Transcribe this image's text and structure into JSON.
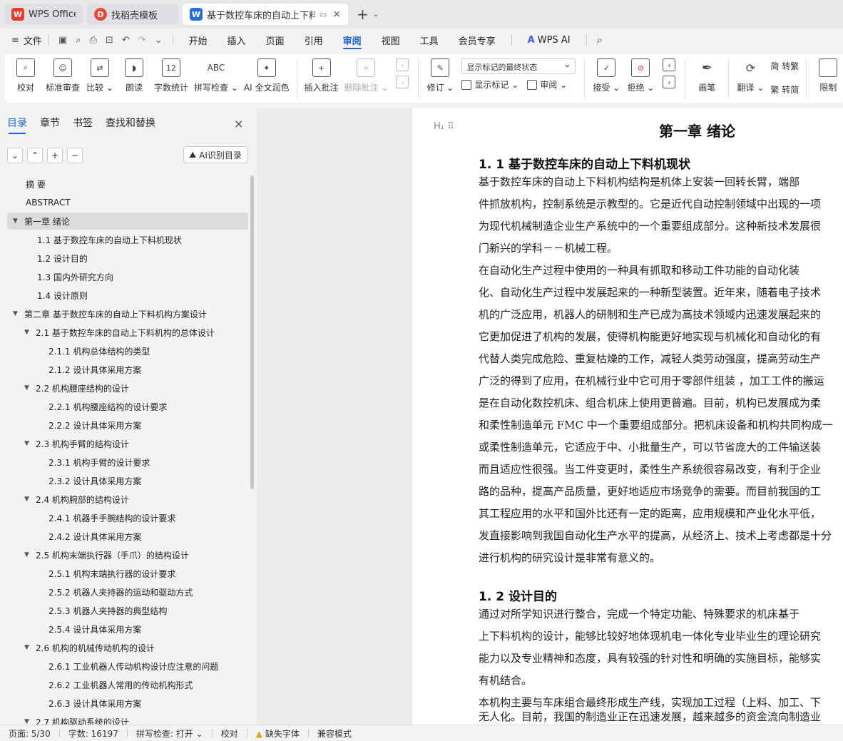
{
  "tabs": [
    {
      "label": "WPS Office",
      "logo": "W"
    },
    {
      "label": "找稻壳模板",
      "logo": "D"
    },
    {
      "label": "基于数控车床的自动上下料机",
      "logo": "W"
    }
  ],
  "menu": {
    "file": "文件",
    "items": [
      "开始",
      "插入",
      "页面",
      "引用",
      "审阅",
      "视图",
      "工具",
      "会员专享"
    ],
    "ai": "WPS AI",
    "ai_icon": "A"
  },
  "ribbon": {
    "proofread": "校对",
    "std_review": "标准审查",
    "compare": "比较",
    "read_aloud": "朗读",
    "word_count": "字数统计",
    "word_count_icon": "12",
    "spell_check": "拼写检查",
    "spell_icon": "ABC",
    "ai_polish": "AI 全文润色",
    "insert_comment": "插入批注",
    "delete_comment": "删除批注",
    "markup_state": "显示标记的最终状态",
    "track": "修订",
    "show_markup": "显示标记",
    "review": "审阅",
    "accept": "接受",
    "reject": "拒绝",
    "pen": "画笔",
    "translate": "翻译",
    "trad": "简 转繁",
    "simp": "繁 转简",
    "restrict": "限制"
  },
  "sidebar": {
    "tabs": [
      "目录",
      "章节",
      "书签",
      "查找和替换"
    ],
    "ai_toc": "AI识别目录",
    "close_icon": "×",
    "tools": [
      "⌄",
      "⌃",
      "+",
      "−"
    ],
    "toc": [
      {
        "label": "摘  要",
        "level": 0,
        "caret": ""
      },
      {
        "label": "ABSTRACT",
        "level": 0,
        "caret": ""
      },
      {
        "label": "第一章  绪论",
        "level": 0,
        "caret": "▼",
        "selected": true
      },
      {
        "label": "1.1 基于数控车床的自动上下料机现状",
        "level": 1,
        "caret": ""
      },
      {
        "label": "1.2 设计目的",
        "level": 1,
        "caret": ""
      },
      {
        "label": "1.3  国内外研究方向",
        "level": 1,
        "caret": ""
      },
      {
        "label": "1.4  设计原则",
        "level": 1,
        "caret": ""
      },
      {
        "label": "第二章    基于数控车床的自动上下料机构方案设计",
        "level": 0,
        "caret": "▼"
      },
      {
        "label": "2.1 基于数控车床的自动上下料机构的总体设计",
        "level": 1,
        "caret": "▼"
      },
      {
        "label": "2.1.1  机构总体结构的类型",
        "level": 2,
        "caret": ""
      },
      {
        "label": "2.1.2  设计具体采用方案",
        "level": 2,
        "caret": ""
      },
      {
        "label": "2.2  机构腰座结构的设计",
        "level": 1,
        "caret": "▼"
      },
      {
        "label": "2.2.1  机构腰座结构的设计要求",
        "level": 2,
        "caret": ""
      },
      {
        "label": "2.2.2  设计具体采用方案",
        "level": 2,
        "caret": ""
      },
      {
        "label": "2.3  机构手臂的结构设计",
        "level": 1,
        "caret": "▼"
      },
      {
        "label": "2.3.1  机构手臂的设计要求",
        "level": 2,
        "caret": ""
      },
      {
        "label": "2.3.2  设计具体采用方案",
        "level": 2,
        "caret": ""
      },
      {
        "label": "2.4  机构腕部的结构设计",
        "level": 1,
        "caret": "▼"
      },
      {
        "label": "2.4.1   机器手手腕结构的设计要求",
        "level": 2,
        "caret": ""
      },
      {
        "label": "2.4.2 设计具体采用方案",
        "level": 2,
        "caret": ""
      },
      {
        "label": "2.5 机构末端执行器（手爪）的结构设计",
        "level": 1,
        "caret": "▼"
      },
      {
        "label": "2.5.1 机构末端执行器的设计要求",
        "level": 2,
        "caret": ""
      },
      {
        "label": "2.5.2 机器人夹持器的运动和驱动方式",
        "level": 2,
        "caret": ""
      },
      {
        "label": "2.5.3  机器人夹持器的典型结构",
        "level": 2,
        "caret": ""
      },
      {
        "label": "2.5.4 设计具体采用方案",
        "level": 2,
        "caret": ""
      },
      {
        "label": "2.6 机构的机械传动机构的设计",
        "level": 1,
        "caret": "▼"
      },
      {
        "label": "2.6.1 工业机器人传动机构设计应注意的问题",
        "level": 2,
        "caret": ""
      },
      {
        "label": "2.6.2 工业机器人常用的传动机构形式",
        "level": 2,
        "caret": ""
      },
      {
        "label": "2.6.3  设计具体采用方案",
        "level": 2,
        "caret": ""
      },
      {
        "label": "2.7 机构驱动系统的设计",
        "level": 1,
        "caret": "▼"
      }
    ]
  },
  "doc": {
    "chapter": "第一章  绪论",
    "s1": "1. 1 基于数控车床的自动上下料机现状",
    "p1": [
      "      基于数控车床的自动上下料机构结构是机体上安装一回转长臂，端部",
      "件抓放机构，控制系统是示教型的。它是近代自动控制领域中出现的一项",
      "为现代机械制造企业生产系统中的一个重要组成部分。这种新技术发展很",
      "门新兴的学科－－机械工程。"
    ],
    "p2": [
      "      在自动化生产过程中使用的一种具有抓取和移动工件功能的自动化装",
      "化、自动化生产过程中发展起来的一种新型装置。近年来，随着电子技术",
      "机的广泛应用，机器人的研制和生产已成为高技术领域内迅速发展起来的",
      "它更加促进了机构的发展，使得机构能更好地实现与机械化和自动化的有",
      "代替人类完成危险、重复枯燥的工作，减轻人类劳动强度，提高劳动生产",
      "广泛的得到了应用，在机械行业中它可用于零部件组装 ，加工工件的搬运",
      "是在自动化数控机床、组合机床上使用更普遍。目前，机构已发展成为柔",
      "和柔性制造单元 FMC 中一个重要组成部分。把机床设备和机构共同构成一",
      "或柔性制造单元，它适应于中、小批量生产，可以节省庞大的工件输送装",
      "而且适应性很强。当工件变更时，柔性生产系统很容易改变，有利于企业",
      "路的品种，提高产品质量，更好地适应市场竞争的需要。而目前我国的工",
      "其工程应用的水平和国外比还有一定的距离，应用规模和产业化水平低，",
      "发直接影响到我国自动化生产水平的提高，从经济上、技术上考虑都是十分",
      "进行机构的研究设计是非常有意义的。"
    ],
    "s2": "1. 2 设计目的",
    "p3": [
      "      通过对所学知识进行整合，完成一个特定功能、特殊要求的机床基于",
      "上下料机构的设计，能够比较好地体现机电一体化专业毕业生的理论研究",
      "能力以及专业精神和态度，具有较强的针对性和明确的实施目标，能够实",
      "有机结合。"
    ],
    "p4": [
      "本机构主要与车床组合最终形成生产线，实现加工过程（上料、加工、下",
      "无人化。目前，我国的制造业正在迅速发展，越来越多的资金流向制造业"
    ]
  },
  "status": {
    "page": "页面: 5/30",
    "words": "字数: 16197",
    "spell": "拼写检查: 打开",
    "proof": "校对",
    "font": "缺失字体",
    "compat": "兼容模式"
  },
  "colors": {
    "accent": "#1e64d6",
    "wps_red": "#e83b2e"
  }
}
